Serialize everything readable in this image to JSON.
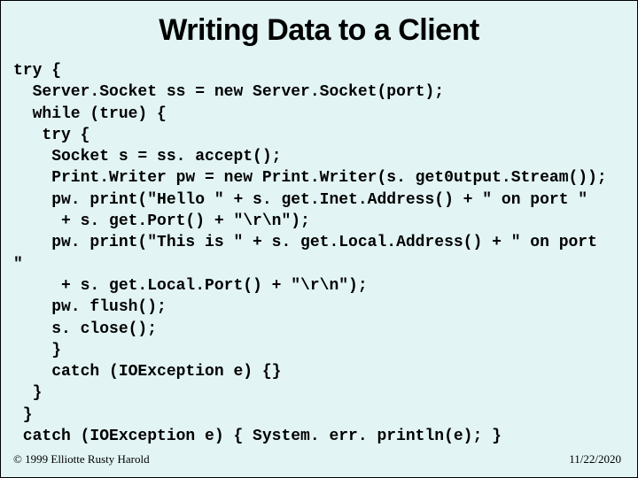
{
  "title": "Writing Data to a Client",
  "code": "try {\n  Server.Socket ss = new Server.Socket(port);\n  while (true) {\n   try {\n    Socket s = ss. accept();\n    Print.Writer pw = new Print.Writer(s. get0utput.Stream());\n    pw. print(\"Hello \" + s. get.Inet.Address() + \" on port \"\n     + s. get.Port() + \"\\r\\n\");\n    pw. print(\"This is \" + s. get.Local.Address() + \" on port\n\"\n     + s. get.Local.Port() + \"\\r\\n\");\n    pw. flush();\n    s. close();\n    }\n    catch (IOException e) {}\n  }\n }\n catch (IOException e) { System. err. println(e); }",
  "footer_left": "© 1999 Elliotte Rusty Harold",
  "footer_right": "11/22/2020"
}
